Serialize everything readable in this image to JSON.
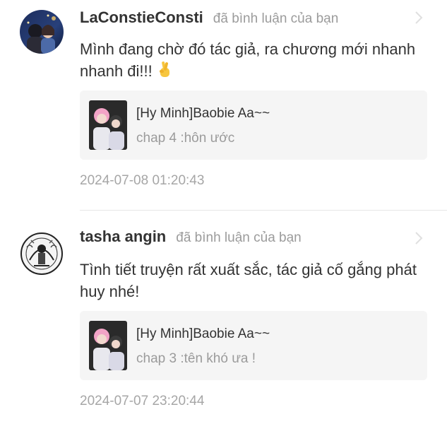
{
  "comments": [
    {
      "username": "LaConstieConsti",
      "action": "đã bình luận của bạn",
      "text": "Mình đang chờ đó tác giả, ra chương mới nhanh nhanh đi!!!",
      "emoji_icon": "crossed-fingers-icon",
      "story_title": "[Hy Minh]Baobie Aa~~",
      "chapter": "chap 4 :hôn ước",
      "timestamp": "2024-07-08 01:20:43"
    },
    {
      "username": "tasha angin",
      "action": "đã bình luận của bạn",
      "text": "Tình tiết truyện rất xuất sắc, tác giả cố gắng phát huy nhé!",
      "story_title": "[Hy Minh]Baobie Aa~~",
      "chapter": "chap 3 :tên khó ưa !",
      "timestamp": "2024-07-07 23:20:44"
    }
  ],
  "colors": {
    "primary_text": "#333333",
    "secondary_text": "#9b9b9b",
    "card_background": "#f5f5f5",
    "divider": "#e6e6e6"
  }
}
